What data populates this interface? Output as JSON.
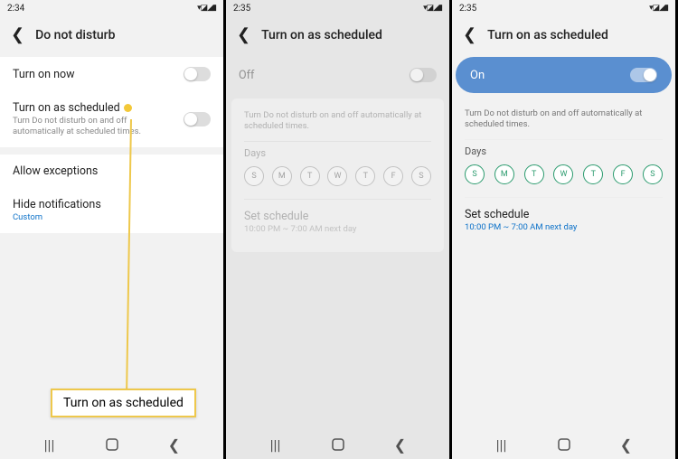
{
  "phone1": {
    "time": "2:34",
    "title": "Do not disturb",
    "turn_on_now": "Turn on now",
    "turn_on_scheduled": "Turn on as scheduled",
    "turn_on_scheduled_sub": "Turn Do not disturb on and off automatically at scheduled times.",
    "allow_exceptions": "Allow exceptions",
    "hide_notifications": "Hide notifications",
    "hide_notifications_sub": "Custom"
  },
  "phone2": {
    "time": "2:35",
    "title": "Turn on as scheduled",
    "toggle_label": "Off",
    "helper": "Turn Do not disturb on and off automatically at scheduled times.",
    "days_label": "Days",
    "days": [
      "S",
      "M",
      "T",
      "W",
      "T",
      "F",
      "S"
    ],
    "set_schedule": "Set schedule",
    "schedule_value": "10:00 PM ~ 7:00 AM next day"
  },
  "phone3": {
    "time": "2:35",
    "title": "Turn on as scheduled",
    "toggle_label": "On",
    "helper": "Turn Do not disturb on and off automatically at scheduled times.",
    "days_label": "Days",
    "days": [
      "S",
      "M",
      "T",
      "W",
      "T",
      "F",
      "S"
    ],
    "set_schedule": "Set schedule",
    "schedule_value": "10:00 PM ~ 7:00 AM next day"
  },
  "callout_text": "Turn on as scheduled"
}
